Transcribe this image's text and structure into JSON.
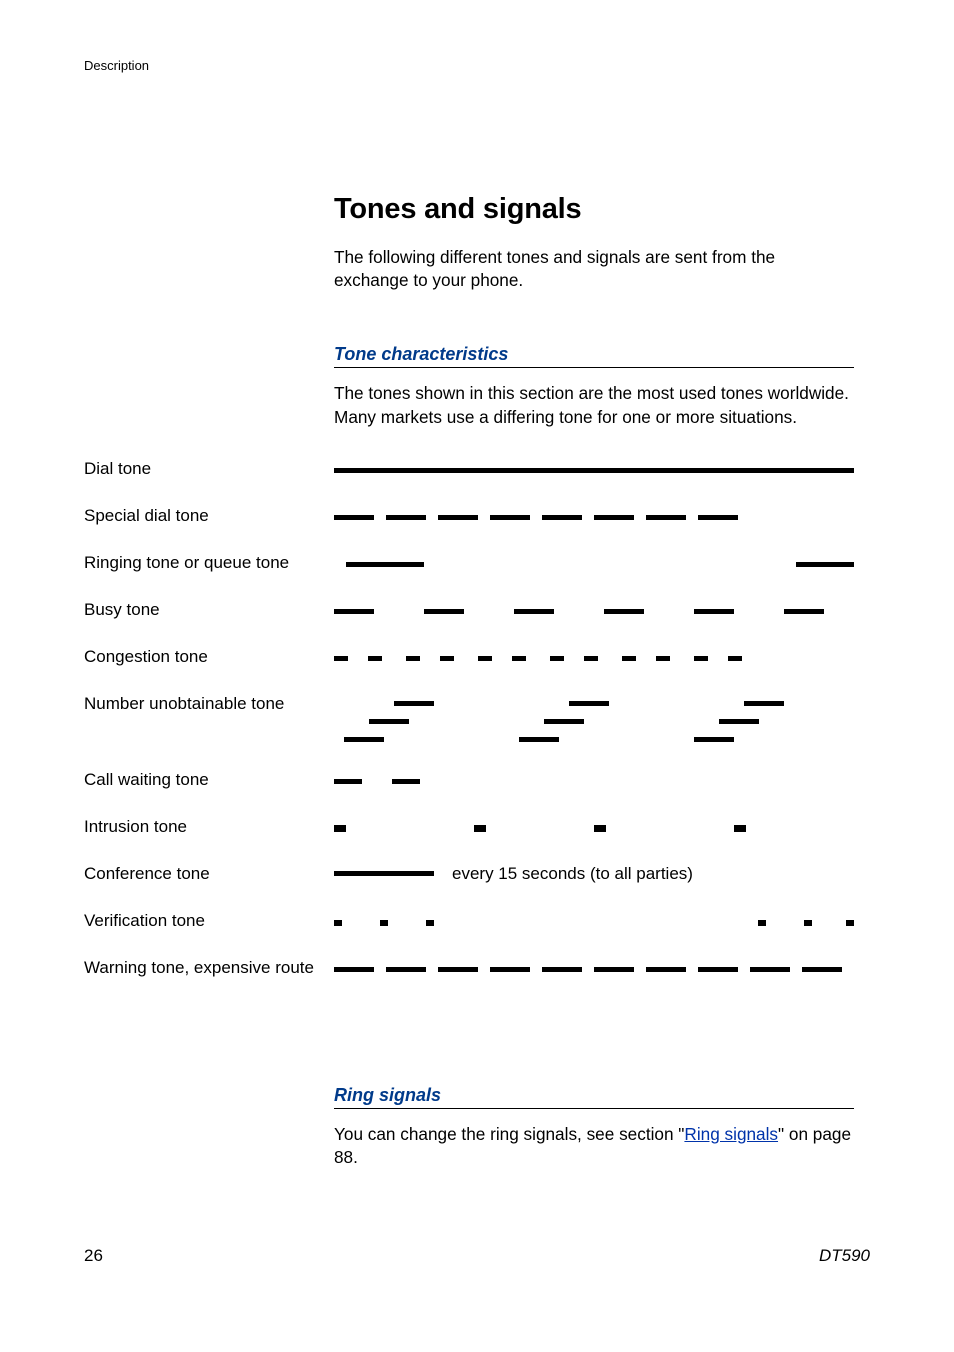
{
  "header": {
    "label": "Description"
  },
  "title": "Tones and signals",
  "intro": "The following different tones and signals are sent from the exchange to your phone.",
  "tone_section": {
    "heading": "Tone characteristics",
    "text": "The tones shown in this section are the most used tones worldwide. Many markets use a differing tone for one or more situations."
  },
  "tones": {
    "dial": "Dial tone",
    "special_dial": "Special dial tone",
    "ringing": "Ringing tone or queue tone",
    "busy": "Busy tone",
    "congestion": "Congestion tone",
    "unobtainable": "Number unobtainable tone",
    "call_waiting": "Call waiting tone",
    "intrusion": "Intrusion tone",
    "conference": "Conference tone",
    "conference_note": "every 15 seconds (to all parties)",
    "verification": "Verification tone",
    "warning": "Warning tone, expensive route"
  },
  "ring_section": {
    "heading": "Ring signals",
    "text_before": "You can change the ring signals, see section \"",
    "link": "Ring signals",
    "text_after": "\" on page 88."
  },
  "footer": {
    "page": "26",
    "model": "DT590"
  }
}
